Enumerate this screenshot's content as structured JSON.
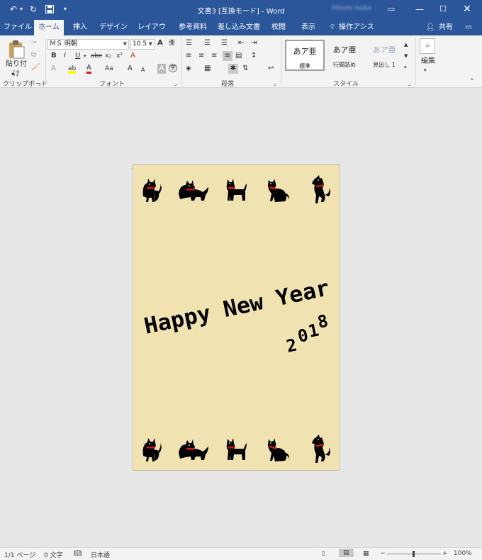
{
  "window": {
    "title": "文書3 [互換モード] - Word",
    "user": "Hitomi Isobe"
  },
  "tabs": [
    "ファイル",
    "ホーム",
    "挿入",
    "デザイン",
    "レイアウト",
    "参考資料",
    "差し込み文書",
    "校閲",
    "表示",
    "操作アシスト"
  ],
  "share_label": "共有",
  "ribbon": {
    "clipboard": {
      "paste_label": "貼り付け",
      "group_label": "クリップボード"
    },
    "font": {
      "name": "ＭＳ 明朝",
      "size": "10.5",
      "group_label": "フォント",
      "bold": "B",
      "italic": "I",
      "underline": "U",
      "strike": "abc",
      "sub": "x₂",
      "sup": "x²",
      "grow": "A",
      "shrink": "A",
      "case": "Aa",
      "color": "A",
      "highlight": "ab"
    },
    "paragraph": {
      "group_label": "段落"
    },
    "styles": {
      "group_label": "スタイル",
      "items": [
        {
          "sample": "あア亜",
          "name": "標準"
        },
        {
          "sample": "あア亜",
          "name": "行間詰め"
        },
        {
          "sample": "あア亜",
          "name": "見出し 1"
        }
      ]
    },
    "editing": {
      "label": "編集"
    }
  },
  "document": {
    "greeting": "Happy New Year",
    "year": [
      "2",
      "0",
      "1",
      "8"
    ]
  },
  "status": {
    "page": "1/1 ページ",
    "words": "0 文字",
    "language": "日本語",
    "zoom": "100%"
  },
  "colors": {
    "brand": "#2b579a",
    "card": "#f1e2b1",
    "collar": "#d01818"
  }
}
